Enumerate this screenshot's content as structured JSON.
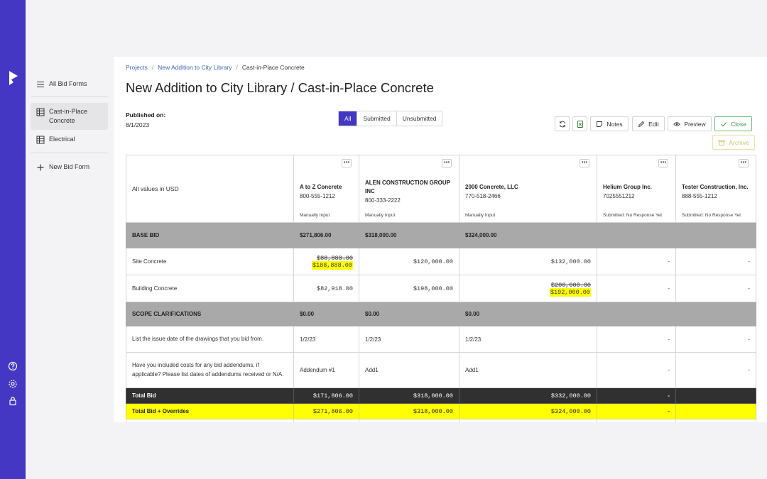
{
  "sidebar": {
    "items": [
      {
        "label": "All Bid Forms",
        "icon": "list-icon"
      },
      {
        "label": "Cast-in-Place Concrete",
        "icon": "grid-icon"
      },
      {
        "label": "Electrical",
        "icon": "grid-icon"
      },
      {
        "label": "New Bid Form",
        "icon": "plus-icon"
      }
    ]
  },
  "breadcrumb": {
    "projects": "Projects",
    "project": "New Addition to City Library",
    "current": "Cast-in-Place Concrete"
  },
  "page_title": "New Addition to City Library / Cast-in-Place Concrete",
  "published": {
    "label": "Published on:",
    "date": "8/1/2023"
  },
  "filter": {
    "all": "All",
    "submitted": "Submitted",
    "unsubmitted": "Unsubmitted",
    "selected": "All"
  },
  "toolbar": {
    "notes": "Notes",
    "edit": "Edit",
    "preview": "Preview",
    "close": "Close",
    "archive": "Archive"
  },
  "table": {
    "corner": "All values in USD",
    "companies": [
      {
        "name": "A to Z Concrete",
        "phone": "800-555-1212",
        "status": "Manually Input"
      },
      {
        "name": "ALEN CONSTRUCTION GROUP INC",
        "phone": "800-333-2222",
        "status": "Manually Input"
      },
      {
        "name": "2000 Concrete, LLC",
        "phone": "770-518-2466",
        "status": "Manually Input"
      },
      {
        "name": "Helium Group Inc.",
        "phone": "7025551212",
        "status": "Submitted: No Response Yet"
      },
      {
        "name": "Tester Construction, Inc.",
        "phone": "888-555-1212",
        "status": "Submitted: No Response Yet"
      }
    ],
    "base_bid": {
      "label": "BASE BID",
      "values": [
        "$271,806.00",
        "$318,000.00",
        "$324,000.00",
        "",
        ""
      ]
    },
    "site_concrete": {
      "label": "Site Concrete",
      "a_old": "$88,888.00",
      "a_new": "$188,888.00",
      "b": "$120,000.00",
      "c": "$132,000.00",
      "d": "-",
      "e": "-"
    },
    "building_concrete": {
      "label": "Building Concrete",
      "a": "$82,918.00",
      "b": "$198,000.00",
      "c_old": "$200,000.00",
      "c_new": "$192,000.00",
      "d": "-",
      "e": "-"
    },
    "scope": {
      "label": "SCOPE CLARIFICATIONS",
      "values": [
        "$0.00",
        "$0.00",
        "$0.00",
        "",
        ""
      ]
    },
    "q1": {
      "label": "List the issue date of the drawings that you bid from.",
      "values": [
        "1/2/23",
        "1/2/23",
        "1/2/23",
        "-",
        "-"
      ]
    },
    "q2": {
      "label": "Have you included costs for any bid addendums, if applicable? Please list dates of addendums received or N/A.",
      "values": [
        "Addendum #1",
        "Add1",
        "Add1",
        "-",
        "-"
      ]
    },
    "total": {
      "label": "Total Bid",
      "values": [
        "$171,806.00",
        "$318,000.00",
        "$332,000.00",
        "-",
        ""
      ]
    },
    "override": {
      "label": "Total Bid + Overrides",
      "values": [
        "$271,806.00",
        "$318,000.00",
        "$324,000.00",
        "-",
        ""
      ]
    }
  },
  "colors": {
    "brand": "#4337c4",
    "highlight": "#ffff00",
    "section": "#a9a9a9",
    "total": "#303030"
  }
}
